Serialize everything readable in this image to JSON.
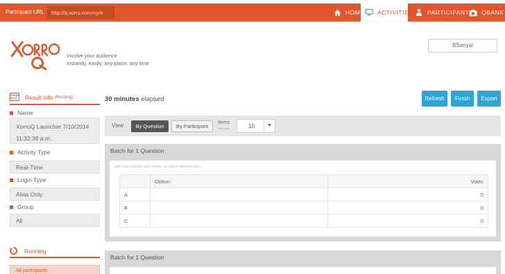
{
  "topbar": {
    "participant_url_label": "Participant URL",
    "participant_url": "http://q.xorro.com/nyrk",
    "nav": [
      {
        "label": "Home",
        "icon": "home-icon"
      },
      {
        "label": "Activities",
        "icon": "presentation-icon"
      },
      {
        "label": "Participants",
        "icon": "person-icon"
      },
      {
        "label": "Qbank",
        "icon": "camera-icon"
      }
    ]
  },
  "brand": {
    "tagline_line1": "Involve your audience",
    "tagline_line2": "Instantly, easily, any place, any time"
  },
  "user": {
    "name": "BSanyal"
  },
  "sidebar": {
    "result_info_label": "Result Info",
    "result_info_status": "(Running)",
    "fields": [
      {
        "label": "Name",
        "value": "XorroQ Launcher 7/10/2014 11:32:38 a.m."
      },
      {
        "label": "Activity Type",
        "value": "Real-Time"
      },
      {
        "label": "Login Type",
        "value": "Alias Only"
      },
      {
        "label": "Group",
        "value": "All"
      }
    ],
    "running_label": "Running",
    "all_participants": "All participants"
  },
  "main": {
    "elapsed_strong": "30 minutes",
    "elapsed_rest": " elapsed",
    "buttons": {
      "refresh": "Refresh",
      "finish": "Finish",
      "export": "Export"
    },
    "toolbar": {
      "view_label": "View",
      "by_question": "By Question",
      "by_participant": "By Participant",
      "items_label": "Items",
      "items_sub": "Per page",
      "items_value": "10"
    },
    "batches": [
      {
        "title": "Batch for 1 Question",
        "description": "Multi-choice (Select One). Answer can only be submitted once.",
        "columns": {
          "option": "Option",
          "votes": "Votes"
        },
        "rows": [
          {
            "letter": "A",
            "option": "",
            "votes": "0"
          },
          {
            "letter": "B",
            "option": "",
            "votes": "0"
          },
          {
            "letter": "C",
            "option": "",
            "votes": "0"
          }
        ]
      },
      {
        "title": "Batch for 1 Question"
      }
    ]
  },
  "colors": {
    "accent": "#e2562b",
    "button": "#2aa6d8",
    "panel": "#d8d8d8"
  }
}
